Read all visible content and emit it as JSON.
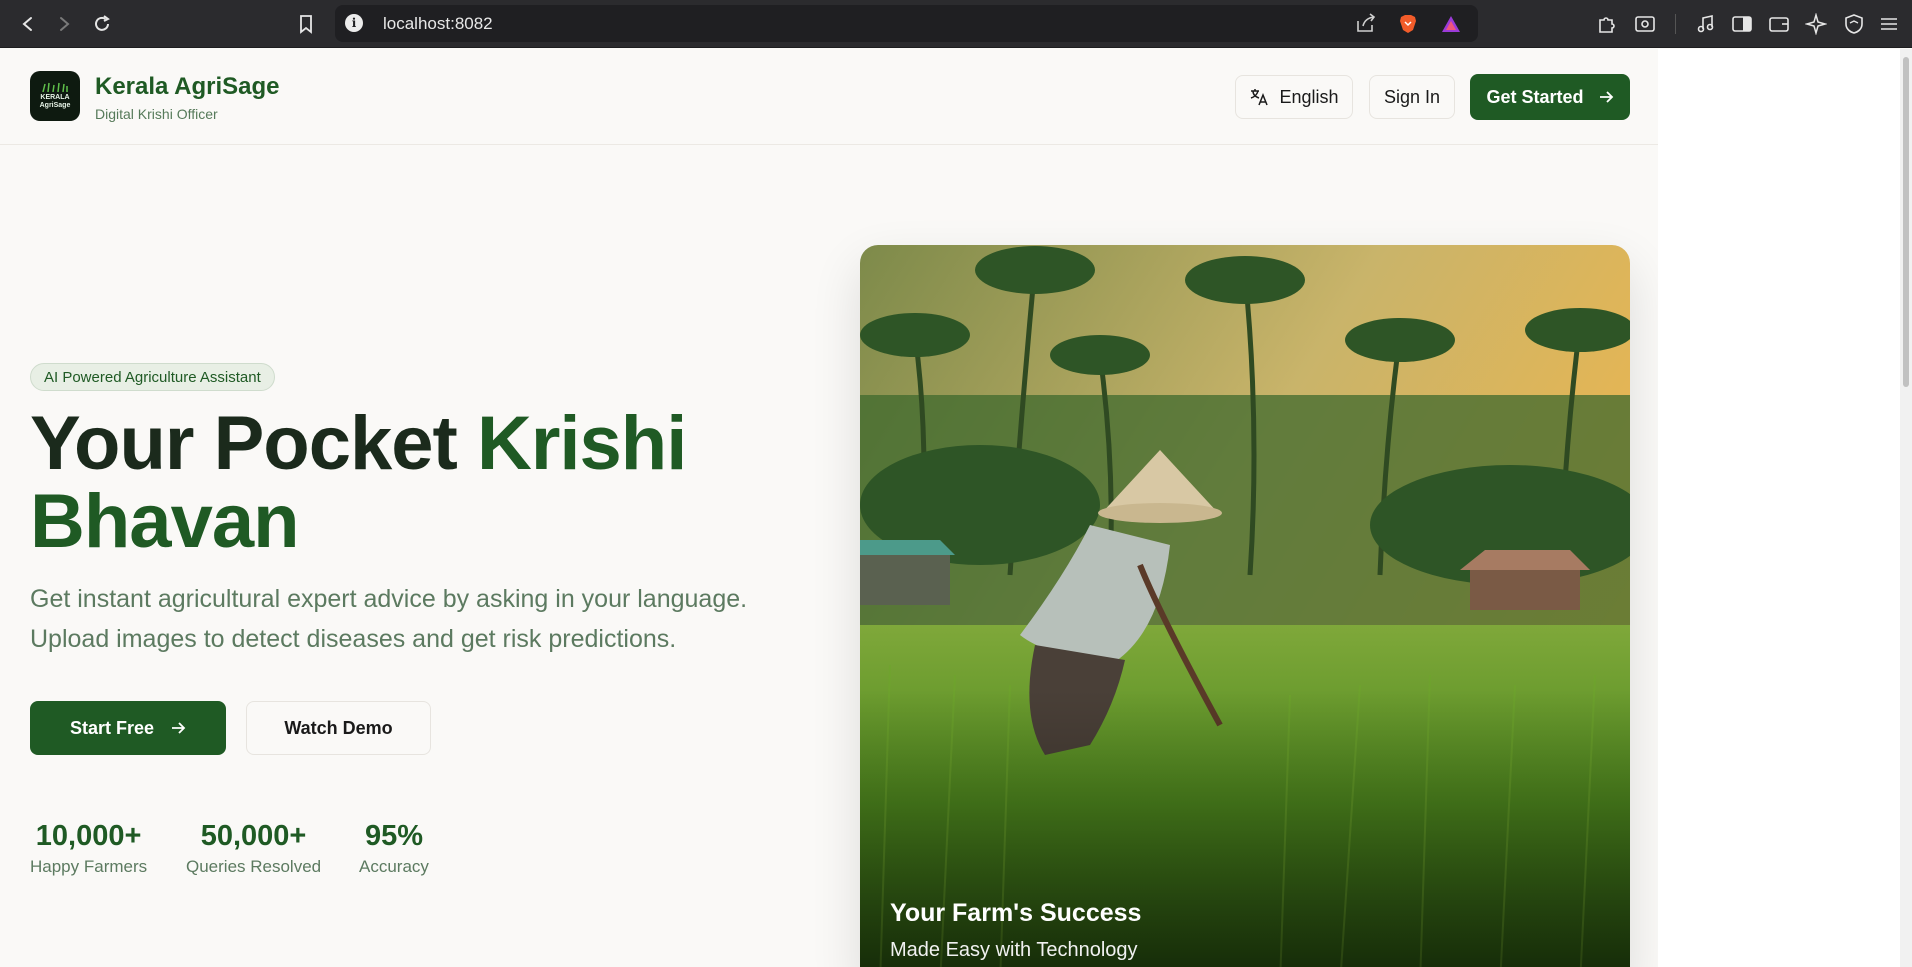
{
  "browser": {
    "url": "localhost:8082",
    "nav_icons": [
      "back-icon",
      "forward-icon",
      "reload-icon",
      "bookmark-icon"
    ],
    "ext_icons": [
      "puzzle-icon",
      "search-page-icon",
      "music-icon",
      "sidebar-icon",
      "wallet-icon",
      "leo-ai-icon",
      "vpn-shield-icon",
      "menu-icon"
    ]
  },
  "header": {
    "brand": {
      "name": "Kerala AgriSage",
      "subtitle": "Digital Krishi Officer",
      "logo_line1": "KERALA",
      "logo_line2": "AgriSage"
    },
    "language_label": "English",
    "signin_label": "Sign In",
    "get_started_label": "Get Started"
  },
  "hero": {
    "badge": "AI Powered Agriculture Assistant",
    "headline_part1": "Your Pocket ",
    "headline_part2": "Krishi Bhavan",
    "description": "Get instant agricultural expert advice by asking in your language. Upload images to detect diseases and get risk predictions.",
    "start_label": "Start Free",
    "demo_label": "Watch Demo",
    "stats": [
      {
        "value": "10,000+",
        "label": "Happy Farmers"
      },
      {
        "value": "50,000+",
        "label": "Queries Resolved"
      },
      {
        "value": "95%",
        "label": "Accuracy"
      }
    ],
    "image_title": "Your Farm's Success",
    "image_subtitle": "Made Easy with Technology"
  },
  "colors": {
    "brand_green": "#1f5a24",
    "text_muted": "#5c7a60",
    "background": "#faf9f7"
  }
}
